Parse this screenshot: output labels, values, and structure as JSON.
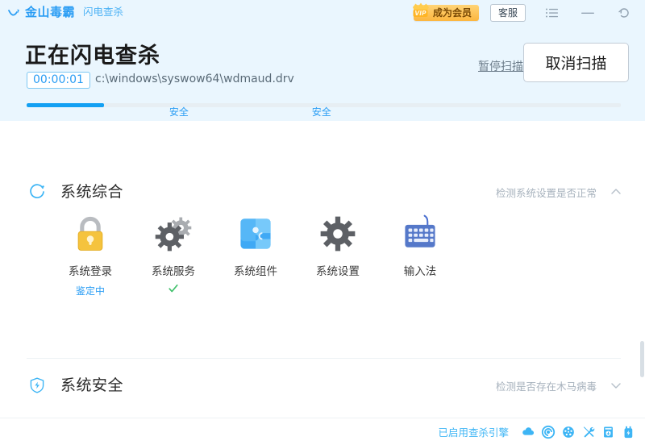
{
  "window": {
    "brand_name": "金山毒霸",
    "brand_sub": "闪电查杀",
    "vip_label": "成为会员",
    "vip_badge_text": "VIP",
    "service_label": "客服",
    "menu_icon": "list-menu-icon",
    "minimize_icon": "minimize-icon",
    "return_icon": "return-arrow-icon",
    "accent": "#2a9df4"
  },
  "scan": {
    "title": "正在闪电查杀",
    "elapsed": "00:00:01",
    "current_path": "c:\\windows\\syswow64\\wdmaud.drv",
    "pause_label": "暂停扫描",
    "cancel_label": "取消扫描",
    "progress_percent": 13,
    "progress_color": "#13a0f3",
    "stages": [
      {
        "label": "安全",
        "position_percent": 24
      },
      {
        "label": "安全",
        "position_percent": 48
      }
    ]
  },
  "sections": [
    {
      "title": "系统综合",
      "desc": "检测系统设置是否正常",
      "icon": "scanning-spinner-icon",
      "chevron": "chevron-up-icon",
      "expanded": true,
      "items": [
        {
          "label": "系统登录",
          "icon": "lock-icon",
          "status": "鉴定中",
          "status_type": "text"
        },
        {
          "label": "系统服务",
          "icon": "gears-icon",
          "status": "",
          "status_type": "check"
        },
        {
          "label": "系统组件",
          "icon": "puzzle-icon",
          "status": "",
          "status_type": "none"
        },
        {
          "label": "系统设置",
          "icon": "gear-icon",
          "status": "",
          "status_type": "none"
        },
        {
          "label": "输入法",
          "icon": "keyboard-icon",
          "status": "",
          "status_type": "none"
        }
      ]
    },
    {
      "title": "系统安全",
      "desc": "检测是否存在木马病毒",
      "icon": "shield-bolt-icon",
      "chevron": "chevron-down-icon",
      "expanded": false,
      "items": []
    }
  ],
  "footer": {
    "status_text": "已启用查杀引擎",
    "icons": [
      "cloud-engine-icon",
      "spiral-engine-icon",
      "virus-globe-icon",
      "tools-icon",
      "shield-file-icon",
      "usb-bolt-icon"
    ]
  }
}
